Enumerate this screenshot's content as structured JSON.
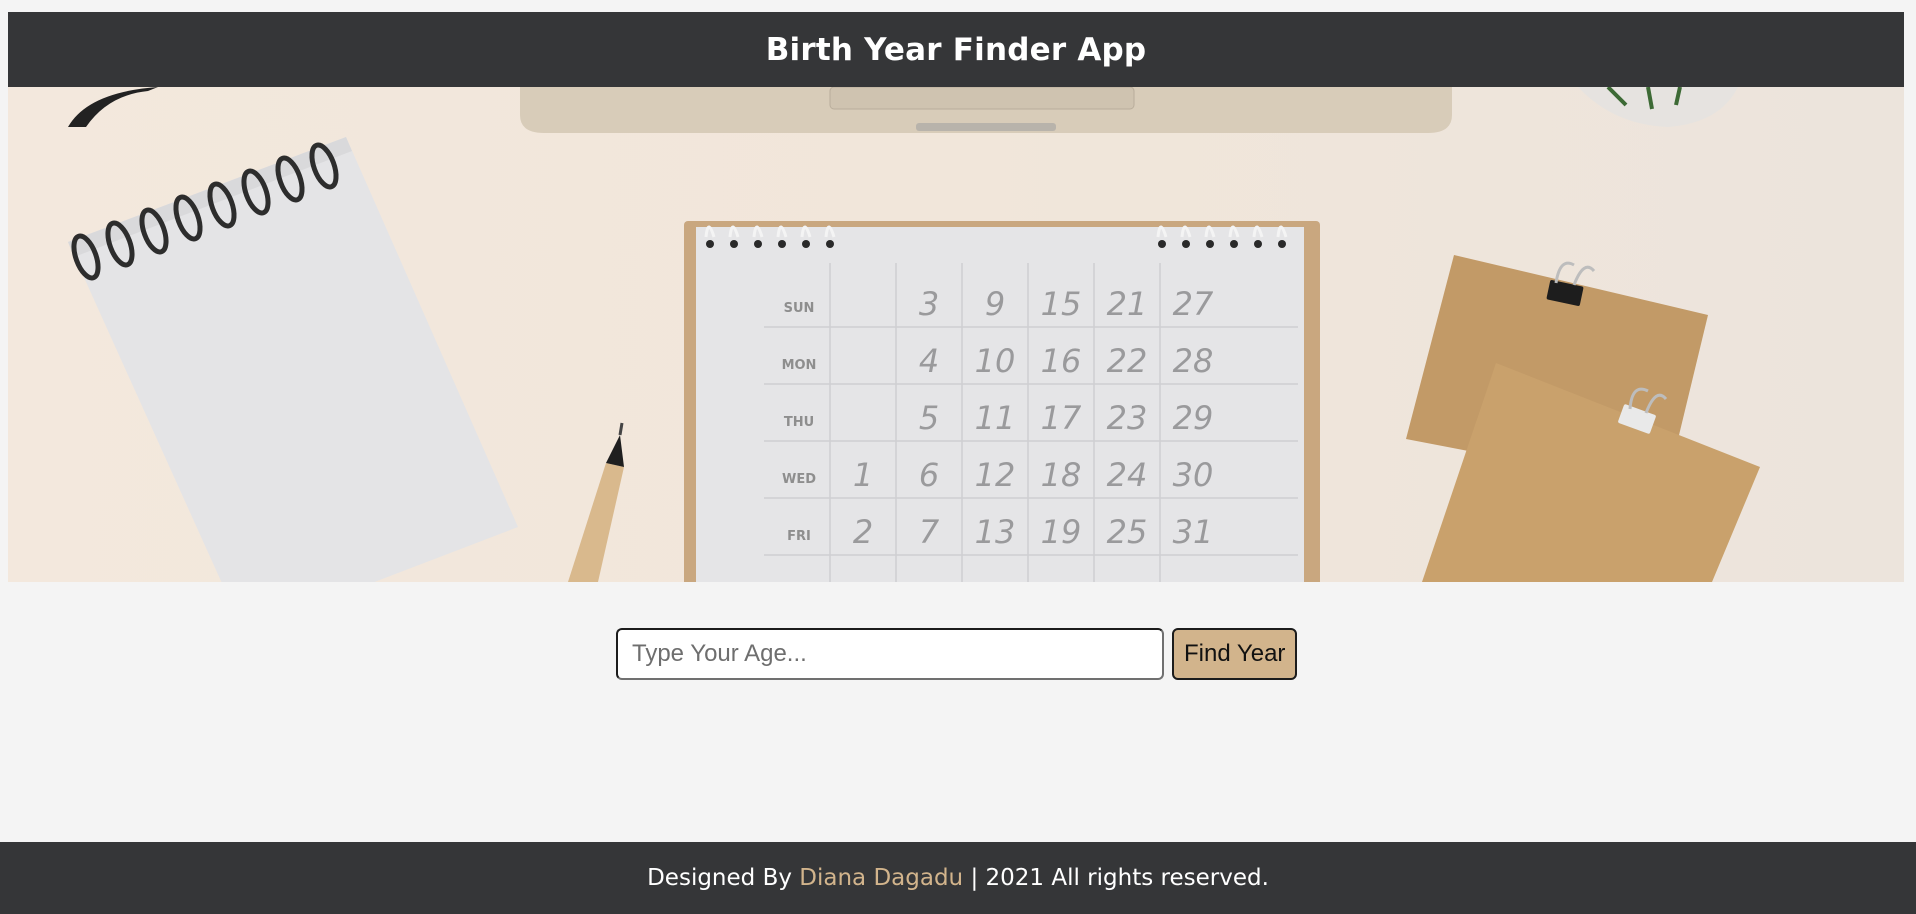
{
  "header": {
    "title": "Birth Year Finder App"
  },
  "hero": {
    "calendar": {
      "day_labels": [
        "SUN",
        "MON",
        "THU",
        "WED",
        "FRI"
      ],
      "rows": [
        [
          "",
          "3",
          "9",
          "15",
          "21",
          "27"
        ],
        [
          "",
          "4",
          "10",
          "16",
          "22",
          "28"
        ],
        [
          "",
          "5",
          "11",
          "17",
          "23",
          "29"
        ],
        [
          "1",
          "6",
          "12",
          "18",
          "24",
          "30"
        ],
        [
          "2",
          "7",
          "13",
          "19",
          "25",
          "31"
        ]
      ]
    }
  },
  "form": {
    "age_input": {
      "value": "",
      "placeholder": "Type Your Age..."
    },
    "find_button_label": "Find Year"
  },
  "footer": {
    "prefix": "Designed By ",
    "author": "Diana Dagadu",
    "suffix": " | 2021 All rights reserved."
  },
  "colors": {
    "header_bg": "#353638",
    "accent": "#d2b48c",
    "page_bg": "#f4f4f4"
  }
}
